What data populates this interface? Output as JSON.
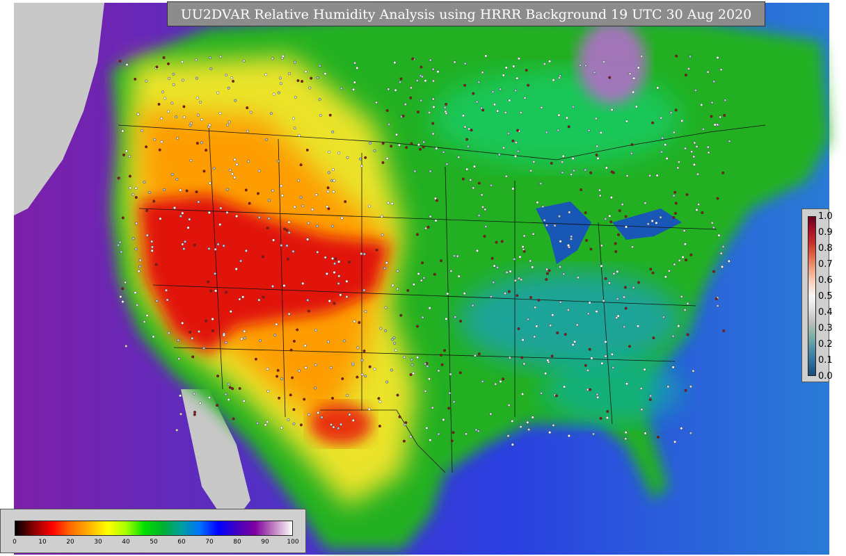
{
  "title": "UU2DVAR Relative Humidity Analysis using HRRR Background 19 UTC 30 Aug 2020",
  "qc_legend": {
    "ticks": [
      "1.0",
      "0.9",
      "0.8",
      "0.7",
      "0.6",
      "0.5",
      "0.4",
      "0.3",
      "0.2",
      "0.1",
      "0.0"
    ],
    "colors": [
      "#67001f",
      "#a50f26",
      "#c9302c",
      "#e06a4c",
      "#f0a483",
      "#f9d4c0",
      "#f7f7f7",
      "#e0e0e0",
      "#bdbdbd",
      "#7fb1a5",
      "#4f8fa8",
      "#2f6f9a",
      "#1c4a78"
    ]
  },
  "rh_legend": {
    "ticks": [
      "0",
      "10",
      "20",
      "30",
      "40",
      "50",
      "60",
      "70",
      "80",
      "90",
      "100"
    ],
    "colors": [
      "#000000",
      "#8b0000",
      "#ff0000",
      "#ff6a00",
      "#ffb300",
      "#ffff00",
      "#a8ff00",
      "#00e000",
      "#00b030",
      "#00a0a0",
      "#0070ff",
      "#0000ff",
      "#4000c0",
      "#8000a0",
      "#c080c0",
      "#ffffff"
    ]
  },
  "colors": {
    "ocean_blue": "#2a4bd6",
    "ocean_violet": "#7d1fa8",
    "land_green": "#22b022",
    "dry_red": "#e01010",
    "dry_orange": "#ff9a00",
    "dry_yellow": "#f5e62a",
    "missing_gray": "#c8c8c8",
    "label_gray": "#8c8c8c"
  }
}
